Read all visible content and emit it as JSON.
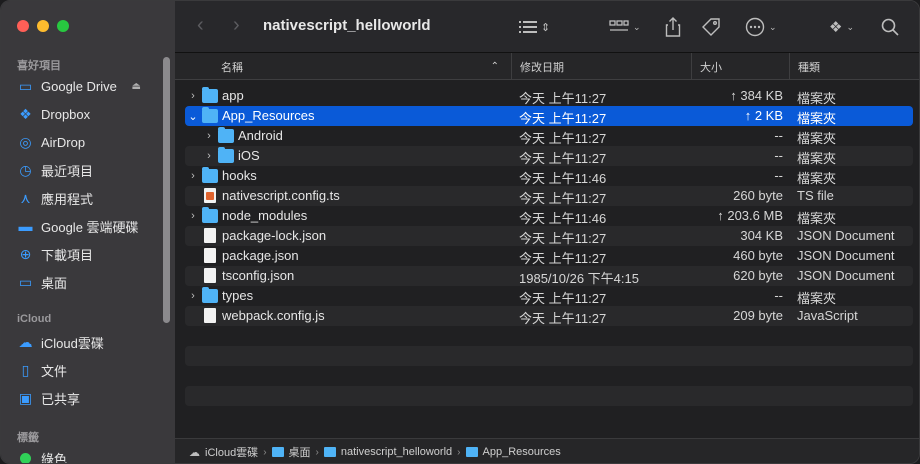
{
  "window": {
    "title": "nativescript_helloworld"
  },
  "sidebar": {
    "sections": [
      {
        "label": "喜好項目"
      },
      {
        "label": "iCloud"
      },
      {
        "label": "標籤"
      }
    ],
    "favorites": [
      {
        "label": "Google Drive",
        "icon": "drive-icon"
      },
      {
        "label": "Dropbox",
        "icon": "dropbox-icon"
      },
      {
        "label": "AirDrop",
        "icon": "airdrop-icon"
      },
      {
        "label": "最近項目",
        "icon": "clock-icon"
      },
      {
        "label": "應用程式",
        "icon": "apps-icon"
      },
      {
        "label": "Google 雲端硬碟",
        "icon": "folder-icon"
      },
      {
        "label": "下載項目",
        "icon": "download-icon"
      },
      {
        "label": "桌面",
        "icon": "desktop-icon"
      }
    ],
    "icloud": [
      {
        "label": "iCloud雲碟",
        "icon": "cloud-icon"
      },
      {
        "label": "文件",
        "icon": "document-icon"
      },
      {
        "label": "已共享",
        "icon": "shared-folder-icon"
      }
    ],
    "tags": [
      {
        "label": "綠色",
        "color": "#30d158"
      }
    ]
  },
  "columns": {
    "name": "名稱",
    "date": "修改日期",
    "size": "大小",
    "kind": "種類"
  },
  "files": [
    {
      "name": "app",
      "date": "今天 上午11:27",
      "size": "↑ 384 KB",
      "kind": "檔案夾",
      "type": "folder",
      "level": 0,
      "expanded": false
    },
    {
      "name": "App_Resources",
      "date": "今天 上午11:27",
      "size": "↑ 2 KB",
      "kind": "檔案夾",
      "type": "folder",
      "level": 0,
      "expanded": true,
      "selected": true
    },
    {
      "name": "Android",
      "date": "今天 上午11:27",
      "size": "--",
      "kind": "檔案夾",
      "type": "folder",
      "level": 1,
      "expanded": false
    },
    {
      "name": "iOS",
      "date": "今天 上午11:27",
      "size": "--",
      "kind": "檔案夾",
      "type": "folder",
      "level": 1,
      "expanded": false
    },
    {
      "name": "hooks",
      "date": "今天 上午11:46",
      "size": "--",
      "kind": "檔案夾",
      "type": "folder",
      "level": 0,
      "expanded": false
    },
    {
      "name": "nativescript.config.ts",
      "date": "今天 上午11:27",
      "size": "260 byte",
      "kind": "TS file",
      "type": "ts",
      "level": 0
    },
    {
      "name": "node_modules",
      "date": "今天 上午11:46",
      "size": "↑ 203.6 MB",
      "kind": "檔案夾",
      "type": "folder",
      "level": 0,
      "expanded": false
    },
    {
      "name": "package-lock.json",
      "date": "今天 上午11:27",
      "size": "304 KB",
      "kind": "JSON Document",
      "type": "doc",
      "level": 0
    },
    {
      "name": "package.json",
      "date": "今天 上午11:27",
      "size": "460 byte",
      "kind": "JSON Document",
      "type": "doc",
      "level": 0
    },
    {
      "name": "tsconfig.json",
      "date": "1985/10/26 下午4:15",
      "size": "620 byte",
      "kind": "JSON Document",
      "type": "doc",
      "level": 0
    },
    {
      "name": "types",
      "date": "今天 上午11:27",
      "size": "--",
      "kind": "檔案夾",
      "type": "folder",
      "level": 0,
      "expanded": false
    },
    {
      "name": "webpack.config.js",
      "date": "今天 上午11:27",
      "size": "209 byte",
      "kind": "JavaScript",
      "type": "doc",
      "level": 0
    }
  ],
  "pathbar": [
    "iCloud雲碟",
    "桌面",
    "nativescript_helloworld",
    "App_Resources"
  ],
  "colors": {
    "accent": "#0a5ad8",
    "folder": "#4fb3f6"
  }
}
